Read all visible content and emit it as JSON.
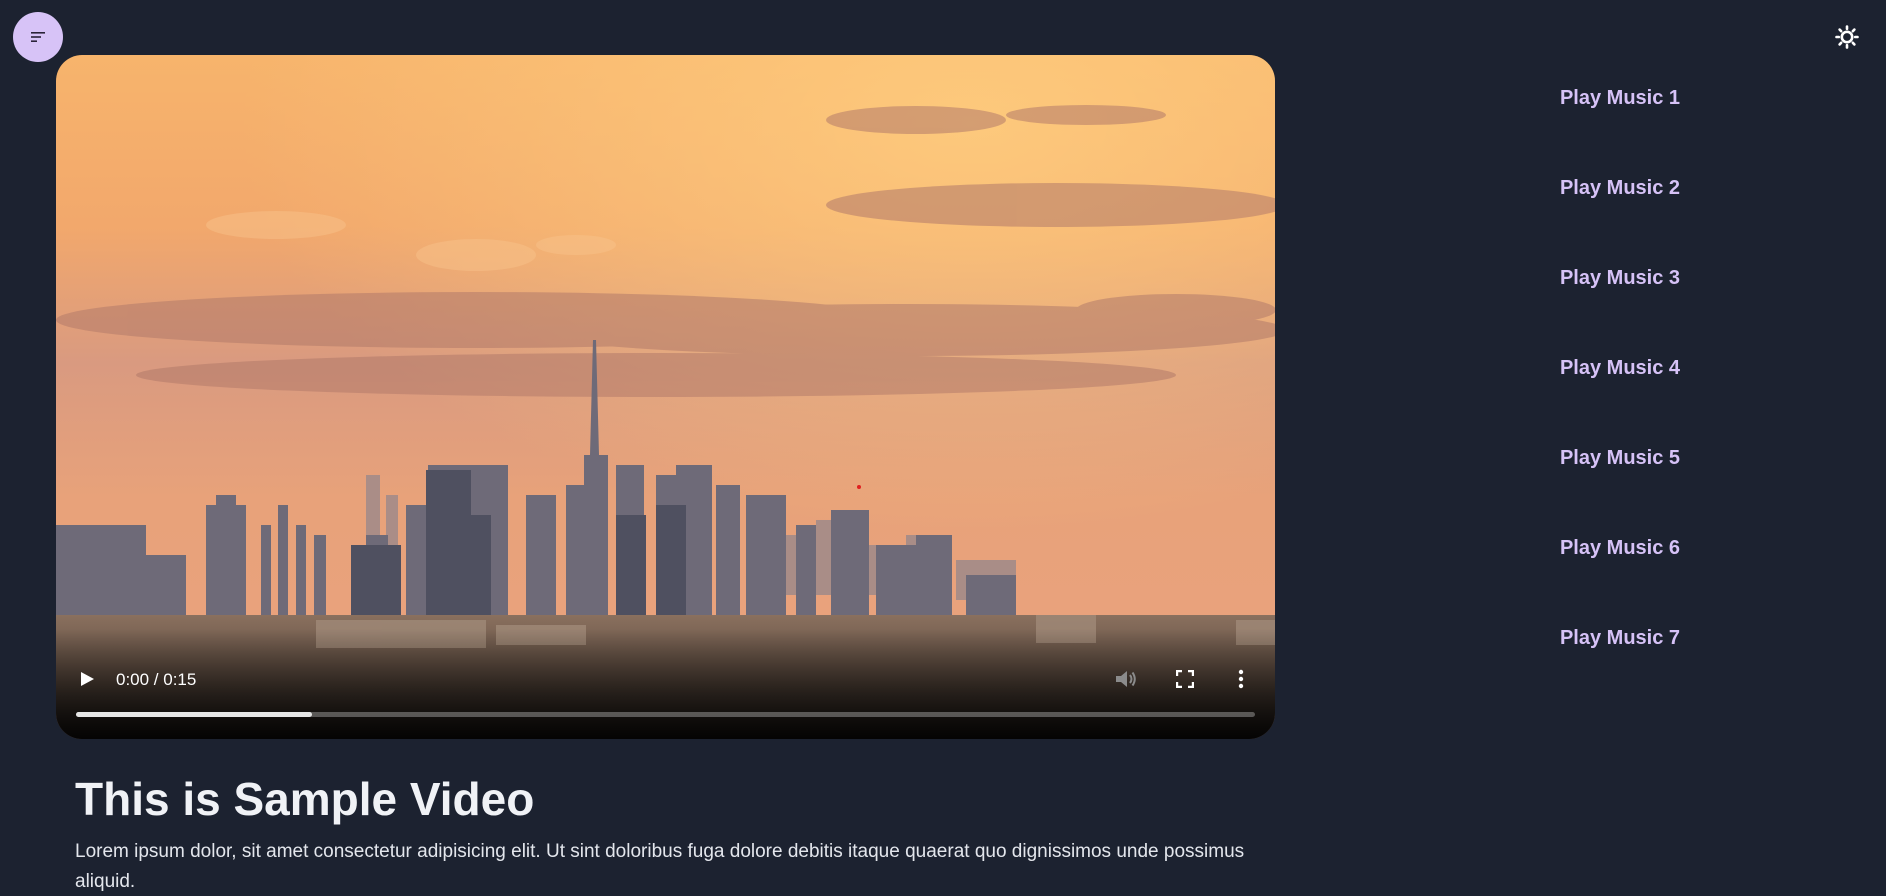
{
  "header": {
    "menu_icon": "sort-lines-icon",
    "theme_icon": "sun-icon"
  },
  "video": {
    "time_display": "0:00 / 0:15",
    "progress_fraction": 0.2,
    "controls": {
      "play_icon": "play-icon",
      "volume_icon": "volume-icon",
      "fullscreen_icon": "fullscreen-icon",
      "more_icon": "more-vertical-icon"
    },
    "title": "This is Sample Video",
    "description": "Lorem ipsum dolor, sit amet consectetur adipisicing elit. Ut sint doloribus fuga dolore debitis itaque quaerat quo dignissimos unde possimus aliquid."
  },
  "playlist": [
    {
      "label": "Play Music 1"
    },
    {
      "label": "Play Music 2"
    },
    {
      "label": "Play Music 3"
    },
    {
      "label": "Play Music 4"
    },
    {
      "label": "Play Music 5"
    },
    {
      "label": "Play Music 6"
    },
    {
      "label": "Play Music 7"
    }
  ],
  "colors": {
    "background": "#1c2230",
    "accent": "#d6c2f7",
    "menu_button": "#d7c3f7",
    "text": "#f0f2f6"
  }
}
